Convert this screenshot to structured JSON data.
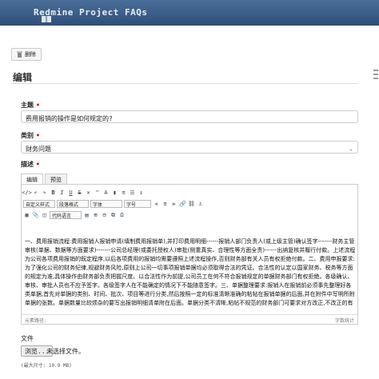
{
  "header": {
    "title": "Redmine Project FAQs"
  },
  "toolbar": {
    "delete_label": "删除"
  },
  "page": {
    "heading": "编辑"
  },
  "form": {
    "subject": {
      "label": "主题",
      "value": "费用报销的操作是如何规定的?"
    },
    "category": {
      "label": "类别",
      "value": "财务问题"
    },
    "description": {
      "label": "描述"
    }
  },
  "editor": {
    "tabs": [
      "编辑",
      "预览"
    ],
    "combos": [
      "自定义样式",
      "段落格式",
      "字体",
      "字号",
      "代码语言"
    ],
    "content": "一、费用报销流程:费用报销人报销申请(填制费用报销单),并打印费用明细------报销人部门负责人(或上级主管)确认签字-------财务主管审核(单据、数据等方面要求)-------公司总经理(或委托授权人)审批(侧重真实、合理性等方面全责)------出纳复核并履行付款。上述流程为公司各项费用报销的既定程序,以后各项费用的报销均需要遵照上述流程操作,否则财务部有关人员有权拒绝付款。二、费用申报要求:为了强化公司的财务纪律,规避财务风险,原则上公司一切事项报销单据均必须取得合法的凭证。合法性的认定以国家财务、税务等方面的规定为准,具体操作由财务部负责把握尺度。以合法性作为前提,公司员工在何不符合报销规定的单据财务部门有权拒绝。各级确认、审核、审批人员也不应予签字。各级签字人在不能确定的情况下不能随意签字。三、单据整理要求:报销人在报销前必须事先整理好各类单据,首先对单据的类别、时间、批次、项目等进行分类,然后按照一定的标准清晰准确的粘帖在报销单据的后面,并在附件中写明所附单据的张数。单据数量比较烦杂的要写出报销明细清单附在后面。单据分类不清晰,粘帖不规范的财务部门可要求对方改正,不改正的有权予以拒绝受理。",
    "status_left": "元素路径:",
    "status_right": "字数统计"
  },
  "file": {
    "label": "文件",
    "browse_label": "浏览...",
    "no_file": "未选择文件。",
    "max_size": "(最大尺寸: 10.9 MB)"
  },
  "watermark": "Ro"
}
